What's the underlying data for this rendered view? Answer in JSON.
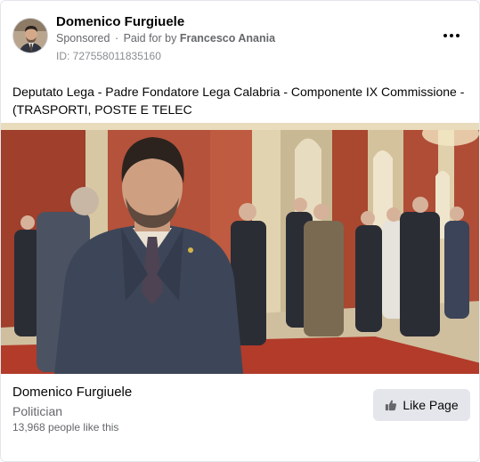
{
  "ad": {
    "page_name": "Domenico Furgiuele",
    "sponsored_label": "Sponsored",
    "paid_for_prefix": "Paid for by",
    "payer": "Francesco Anania",
    "ad_id": "ID: 727558011835160",
    "menu_icon": "more-horizontal-icon"
  },
  "post": {
    "text": "Deputato Lega - Padre Fondatore Lega Calabria - Componente IX Commissione - (TRASPORTI, POSTE E TELEC"
  },
  "footer": {
    "page_name": "Domenico Furgiuele",
    "category": "Politician",
    "likes": "13,968 people like this",
    "like_button_label": "Like Page",
    "like_icon": "thumbs-up-icon"
  },
  "colors": {
    "secondary_text": "#65676b",
    "button_bg": "#e4e6eb",
    "primary_text": "#050505"
  }
}
